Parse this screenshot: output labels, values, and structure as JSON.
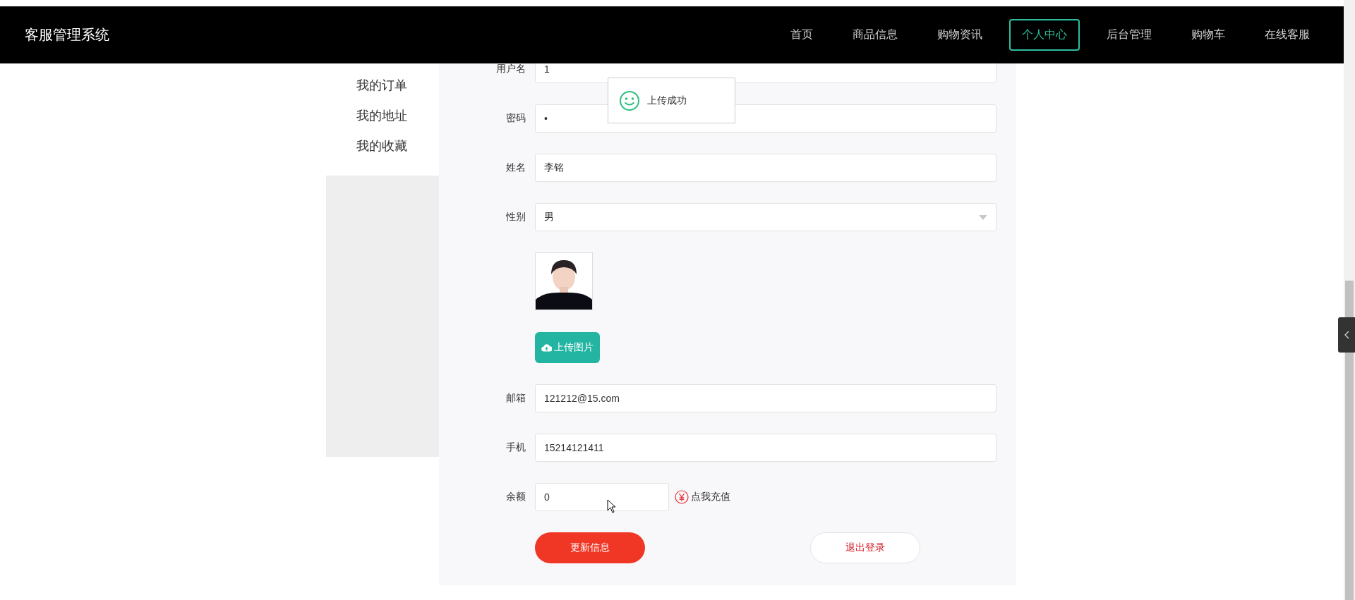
{
  "nav": {
    "brand": "客服管理系统",
    "items": [
      {
        "label": "首页",
        "selected": false
      },
      {
        "label": "商品信息",
        "selected": false
      },
      {
        "label": "购物资讯",
        "selected": false
      },
      {
        "label": "个人中心",
        "selected": true
      },
      {
        "label": "后台管理",
        "selected": false
      },
      {
        "label": "购物车",
        "selected": false
      },
      {
        "label": "在线客服",
        "selected": false
      }
    ]
  },
  "sidebar": {
    "items": [
      {
        "label": "我的订单"
      },
      {
        "label": "我的地址"
      },
      {
        "label": "我的收藏"
      }
    ]
  },
  "form": {
    "fields": [
      {
        "kind": "text",
        "label": "用户名",
        "value": "1"
      },
      {
        "kind": "text",
        "label": "密码",
        "value": "•"
      },
      {
        "kind": "text",
        "label": "姓名",
        "value": "李铭"
      },
      {
        "kind": "select",
        "label": "性别",
        "value": "男"
      },
      {
        "kind": "avatar",
        "button": "上传图片"
      },
      {
        "kind": "text",
        "label": "邮箱",
        "value": "121212@15.com"
      },
      {
        "kind": "text",
        "label": "手机",
        "value": "15214121411"
      },
      {
        "kind": "balance",
        "label": "余额",
        "value": "0",
        "link": "点我充值"
      }
    ],
    "buttons": [
      {
        "kind": "primary",
        "label": "更新信息"
      },
      {
        "kind": "secondary",
        "label": "退出登录"
      }
    ]
  },
  "toast": {
    "message": "上传成功"
  }
}
